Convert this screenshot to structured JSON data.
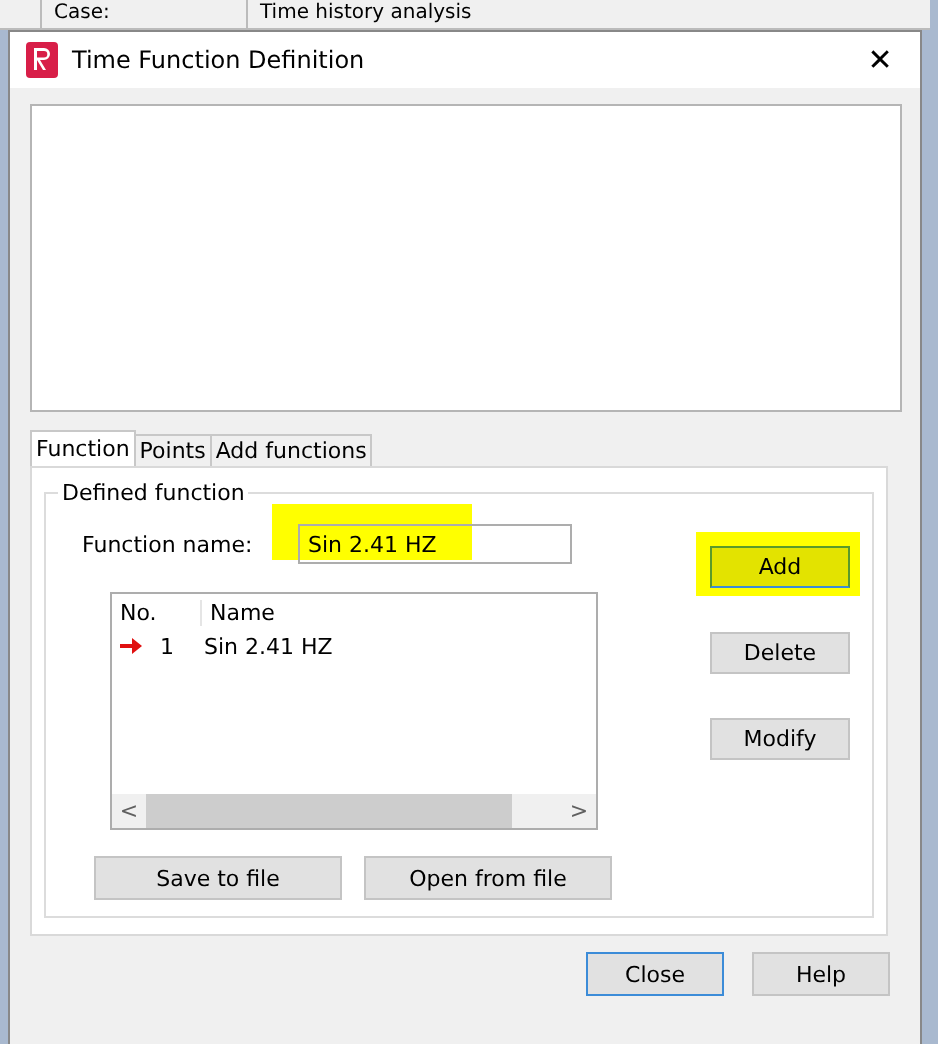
{
  "background_window": {
    "cells": [
      "Case:",
      "Time history analysis"
    ]
  },
  "window": {
    "title": "Time Function Definition",
    "close": "✕"
  },
  "tabs": [
    {
      "label": "Function",
      "selected": true
    },
    {
      "label": "Points",
      "selected": false
    },
    {
      "label": "Add functions",
      "selected": false
    }
  ],
  "group": {
    "title": "Defined function",
    "name_label": "Function name:",
    "name_value": "Sin 2.41 HZ",
    "name_highlighted": true
  },
  "list": {
    "columns": [
      "No.",
      "Name"
    ],
    "rows": [
      {
        "no": "1",
        "name": "Sin 2.41 HZ",
        "current": true
      }
    ],
    "scroll_left": "<",
    "scroll_right": ">"
  },
  "side_buttons": [
    {
      "label": "Add",
      "highlighted": true
    },
    {
      "label": "Delete",
      "highlighted": false
    },
    {
      "label": "Modify",
      "highlighted": false
    }
  ],
  "file_buttons": [
    "Save to file",
    "Open from file"
  ],
  "footer_buttons": [
    {
      "label": "Close",
      "default": true
    },
    {
      "label": "Help",
      "default": false
    }
  ]
}
